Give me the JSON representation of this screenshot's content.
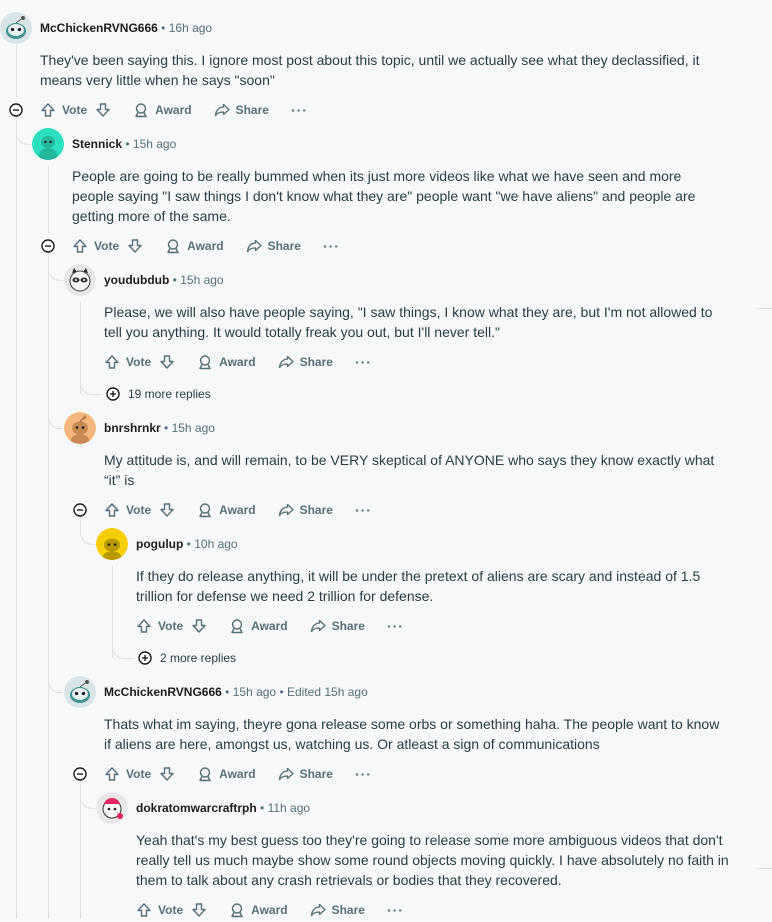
{
  "comments": [
    {
      "user": "McChickenRVNG666",
      "time": "16h ago",
      "avatar": "snoo-cyan-icon",
      "body": "They've been saying this. I ignore most post about this topic, until we actually see what they declassified, it means very little when he says \"soon\""
    },
    {
      "user": "Stennick",
      "time": "15h ago",
      "avatar": "snoo-teal-icon",
      "body": "People are going to be really bummed when its just more videos like what we have seen and more people saying \"I saw things I don't know what they are\" people want \"we have aliens\" and people are getting more of the same."
    },
    {
      "user": "youdubdub",
      "time": "15h ago",
      "avatar": "snoo-raccoon-icon",
      "body": "Please, we will also have people saying, \"I saw things, I know what they are, but I'm not allowed to tell you anything. It would totally freak you out, but I'll never tell.\"",
      "more_replies": "19 more replies"
    },
    {
      "user": "bnrshrnkr",
      "time": "15h ago",
      "avatar": "snoo-orange-icon",
      "body": "My attitude is, and will remain, to be VERY skeptical of ANYONE who says they know exactly what “it” is"
    },
    {
      "user": "pogulup",
      "time": "10h ago",
      "avatar": "snoo-yellow-icon",
      "body": "If they do release anything, it will be under the pretext of aliens are scary and instead of 1.5 trillion for defense we need 2 trillion for defense.",
      "more_replies": "2 more replies"
    },
    {
      "user": "McChickenRVNG666",
      "time": "15h ago",
      "edited": "Edited 15h ago",
      "avatar": "snoo-cyan-icon",
      "body": "Thats what im saying, theyre gona release some orbs or something haha. The people want to know if aliens are here, amongst us, watching us. Or atleast a sign of communications"
    },
    {
      "user": "dokratomwarcraftrph",
      "time": "11h ago",
      "avatar": "snoo-pink-icon",
      "body": "Yeah that's my best guess too they're going to release some more ambiguous videos that don't really tell us much maybe show some round objects moving quickly. I have absolutely no faith in them to talk about any crash retrievals or bodies that they recovered."
    }
  ],
  "actions": {
    "vote": "Vote",
    "award": "Award",
    "share": "Share",
    "more": "···"
  },
  "separator": "•",
  "icons": {
    "upvote": "arrow-up-icon",
    "downvote": "arrow-down-icon",
    "award": "award-icon",
    "share": "share-icon",
    "collapse": "minus-circle-icon",
    "expand": "plus-circle-icon"
  },
  "colors": {
    "background": "#f7f8fa",
    "meta": "#576f76",
    "thread": "#dfe1e4"
  }
}
